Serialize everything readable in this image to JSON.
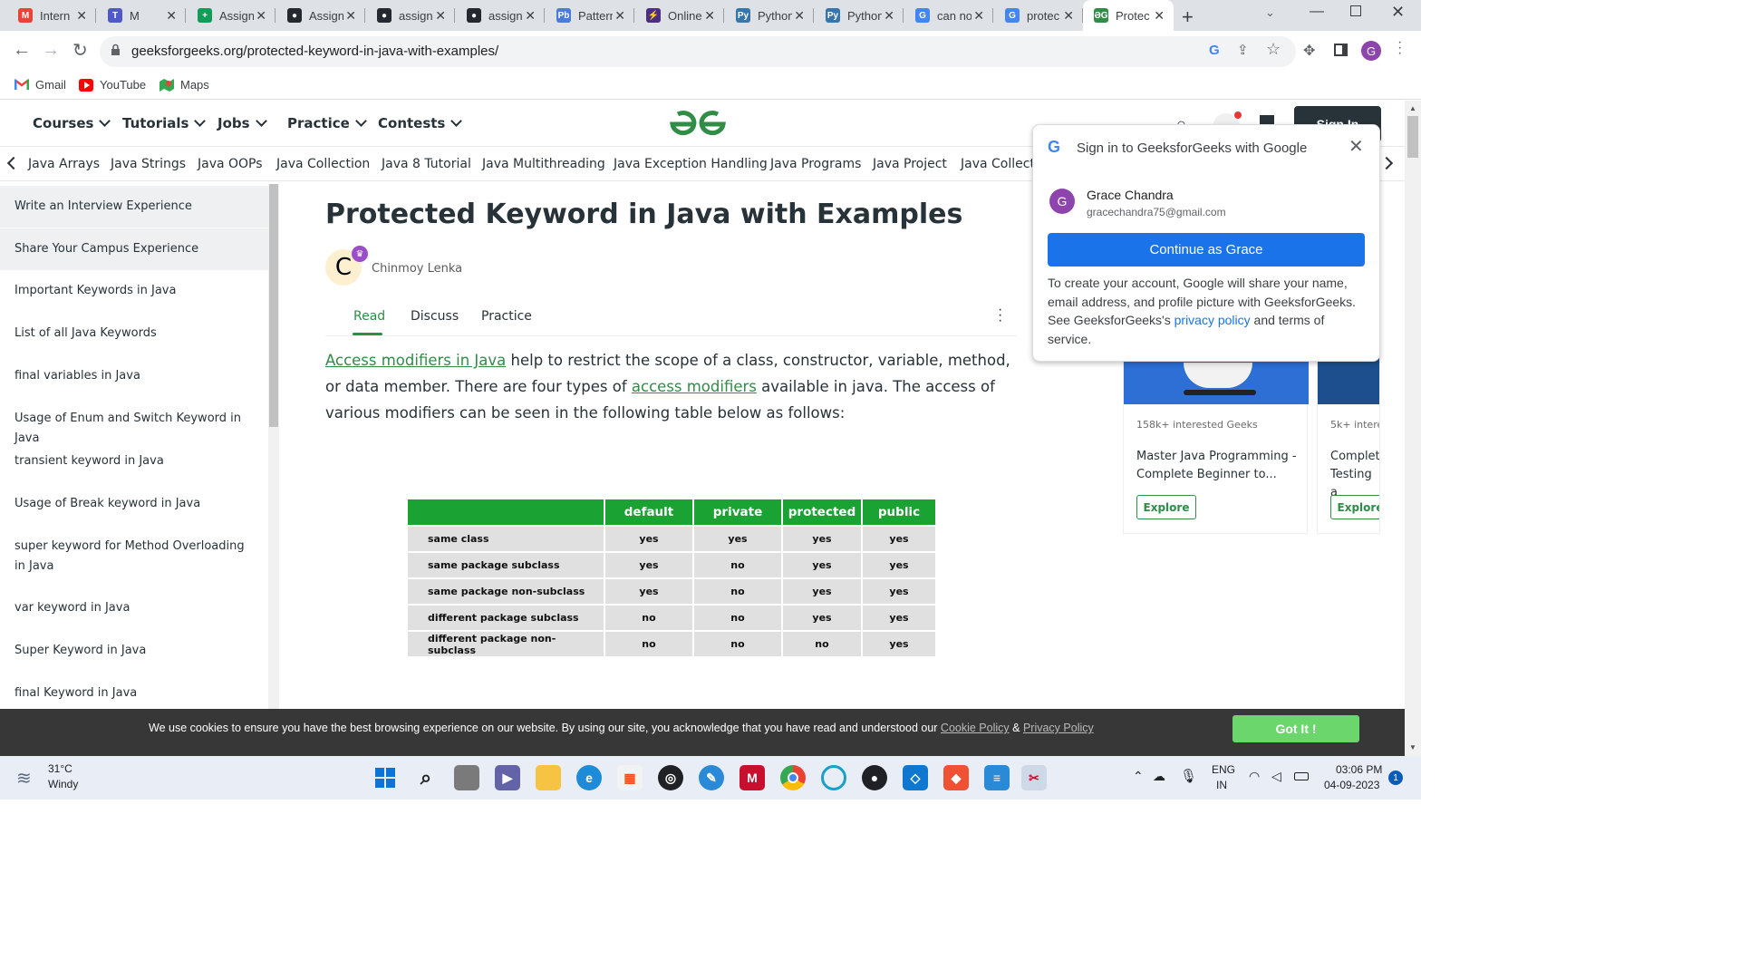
{
  "browser": {
    "tabs": [
      {
        "title": "Intern",
        "icon": "gmail-icon",
        "color": "#ea4335",
        "glyph": "M"
      },
      {
        "title": "M",
        "icon": "teams-icon",
        "color": "#5059c9",
        "glyph": "T"
      },
      {
        "title": "Assign",
        "icon": "sheets-icon",
        "color": "#0f9d58",
        "glyph": "+"
      },
      {
        "title": "Assign",
        "icon": "github-icon",
        "color": "#24292f",
        "glyph": "●"
      },
      {
        "title": "assign",
        "icon": "github-icon",
        "color": "#24292f",
        "glyph": "●"
      },
      {
        "title": "assign",
        "icon": "github-icon",
        "color": "#24292f",
        "glyph": "●"
      },
      {
        "title": "Pattern",
        "icon": "pb-icon",
        "color": "#4a7bd8",
        "glyph": "Pb"
      },
      {
        "title": "Online",
        "icon": "replit-icon",
        "color": "#4b2d83",
        "glyph": "⚡"
      },
      {
        "title": "Python",
        "icon": "python-icon",
        "color": "#3776ab",
        "glyph": "Py"
      },
      {
        "title": "Python",
        "icon": "python-icon",
        "color": "#3776ab",
        "glyph": "Py"
      },
      {
        "title": "can no",
        "icon": "google-icon",
        "color": "#4285f4",
        "glyph": "G"
      },
      {
        "title": "protec",
        "icon": "google-icon",
        "color": "#4285f4",
        "glyph": "G"
      },
      {
        "title": "Protec",
        "icon": "gfg-icon",
        "color": "#2f8d46",
        "glyph": "ƏG"
      }
    ],
    "url": "geeksforgeeks.org/protected-keyword-in-java-with-examples/",
    "bookmarks": [
      {
        "label": "Gmail",
        "icon": "gmail-icon"
      },
      {
        "label": "YouTube",
        "icon": "youtube-icon"
      },
      {
        "label": "Maps",
        "icon": "maps-icon"
      }
    ],
    "profile_initial": "G"
  },
  "site": {
    "main_nav": [
      "Courses",
      "Tutorials",
      "Jobs",
      "Practice",
      "Contests"
    ],
    "sign_in": "Sign In",
    "sub_nav": [
      "Java Arrays",
      "Java Strings",
      "Java OOPs",
      "Java Collection",
      "Java 8 Tutorial",
      "Java Multithreading",
      "Java Exception Handling",
      "Java Programs",
      "Java Project",
      "Java Collecti"
    ]
  },
  "sidebar": {
    "items": [
      "Write an Interview Experience",
      "Share Your Campus Experience",
      "Important Keywords in Java",
      "List of all Java Keywords",
      "final variables in Java",
      "Usage of Enum and Switch Keyword in Java",
      "transient keyword in Java",
      "Usage of Break keyword in Java",
      "super keyword for Method Overloading in Java",
      "var keyword in Java",
      "Super Keyword in Java",
      "final Keyword in Java"
    ]
  },
  "article": {
    "title": "Protected Keyword in Java with Examples",
    "author_initial": "C",
    "author": "Chinmoy Lenka",
    "tabs": [
      "Read",
      "Discuss",
      "Practice"
    ],
    "link1": "Access modifiers in Java",
    "text1": " help to restrict the scope of a class, constructor, variable, method, or data member. There are four types of ",
    "link2": "access modifiers",
    "text2": " available in java. The access of various modifiers can be seen in the following table below as follows:"
  },
  "access_table": {
    "headers": [
      "",
      "default",
      "private",
      "protected",
      "public"
    ],
    "rows": [
      [
        "same class",
        "yes",
        "yes",
        "yes",
        "yes"
      ],
      [
        "same package subclass",
        "yes",
        "no",
        "yes",
        "yes"
      ],
      [
        "same package non-subclass",
        "yes",
        "no",
        "yes",
        "yes"
      ],
      [
        "different package subclass",
        "no",
        "no",
        "yes",
        "yes"
      ],
      [
        "different package non-subclass",
        "no",
        "no",
        "no",
        "yes"
      ]
    ]
  },
  "courses": [
    {
      "interested": "158k+ interested Geeks",
      "title": "Master Java Programming - Complete Beginner to...",
      "button": "Explore"
    },
    {
      "interested": "5k+ intere",
      "title": "Complet Testing a",
      "button": "Explore"
    }
  ],
  "google_signin": {
    "heading": "Sign in to GeeksforGeeks with Google",
    "user_initial": "G",
    "user_name": "Grace Chandra",
    "user_email": "gracechandra75@gmail.com",
    "continue": "Continue as Grace",
    "info_prefix": "To create your account, Google will share your name, email address, and profile picture with GeeksforGeeks. See GeeksforGeeks's ",
    "privacy": "privacy policy",
    "info_suffix": " and terms of service."
  },
  "cookie": {
    "text": "We use cookies to ensure you have the best browsing experience on our website. By using our site, you acknowledge that you have read and understood our ",
    "cookie_policy": "Cookie Policy",
    "amp": " & ",
    "privacy_policy": "Privacy Policy",
    "button": "Got It !"
  },
  "taskbar": {
    "weather_temp": "31°C",
    "weather_desc": "Windy",
    "lang1": "ENG",
    "lang2": "IN",
    "time": "03:06 PM",
    "date": "04-09-2023",
    "notif_count": "1"
  },
  "colors": {
    "gfg_green": "#2f8d46",
    "google_blue": "#1a73e8",
    "cookie_btn": "#6bd66b"
  }
}
